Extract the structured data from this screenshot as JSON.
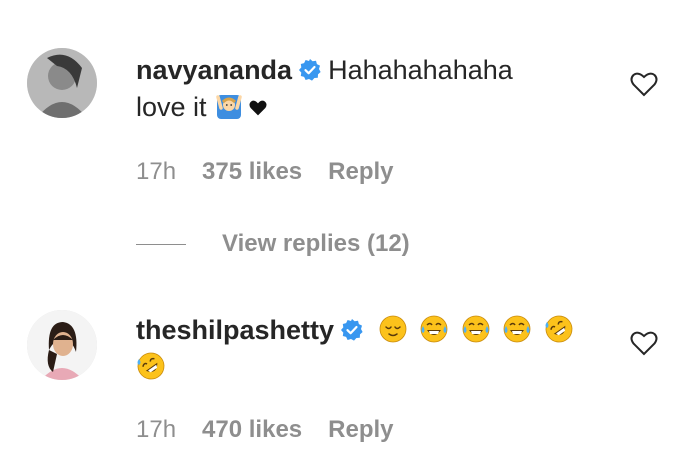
{
  "comments": [
    {
      "username": "navyananda",
      "text_line1": "Hahahahahaha",
      "text_line2": "love it",
      "emojis": [
        "raising-hands-person-emoji",
        "black-heart-emoji"
      ],
      "time": "17h",
      "likes": "375 likes",
      "reply": "Reply"
    },
    {
      "username": "theshilpashetty",
      "text_line1": "",
      "emojis": [
        "relieved-face-emoji",
        "tears-of-joy-emoji",
        "tears-of-joy-emoji",
        "tears-of-joy-emoji",
        "rolling-on-floor-laughing-emoji"
      ],
      "emojis_line2": [
        "rolling-on-floor-laughing-emoji"
      ],
      "time": "17h",
      "likes": "470 likes",
      "reply": "Reply"
    }
  ],
  "view_replies": "View replies (12)",
  "colors": {
    "text": "#262626",
    "secondary": "#8e8e8e",
    "verified": "#3897f0",
    "emoji_yellow": "#fcc21b"
  }
}
